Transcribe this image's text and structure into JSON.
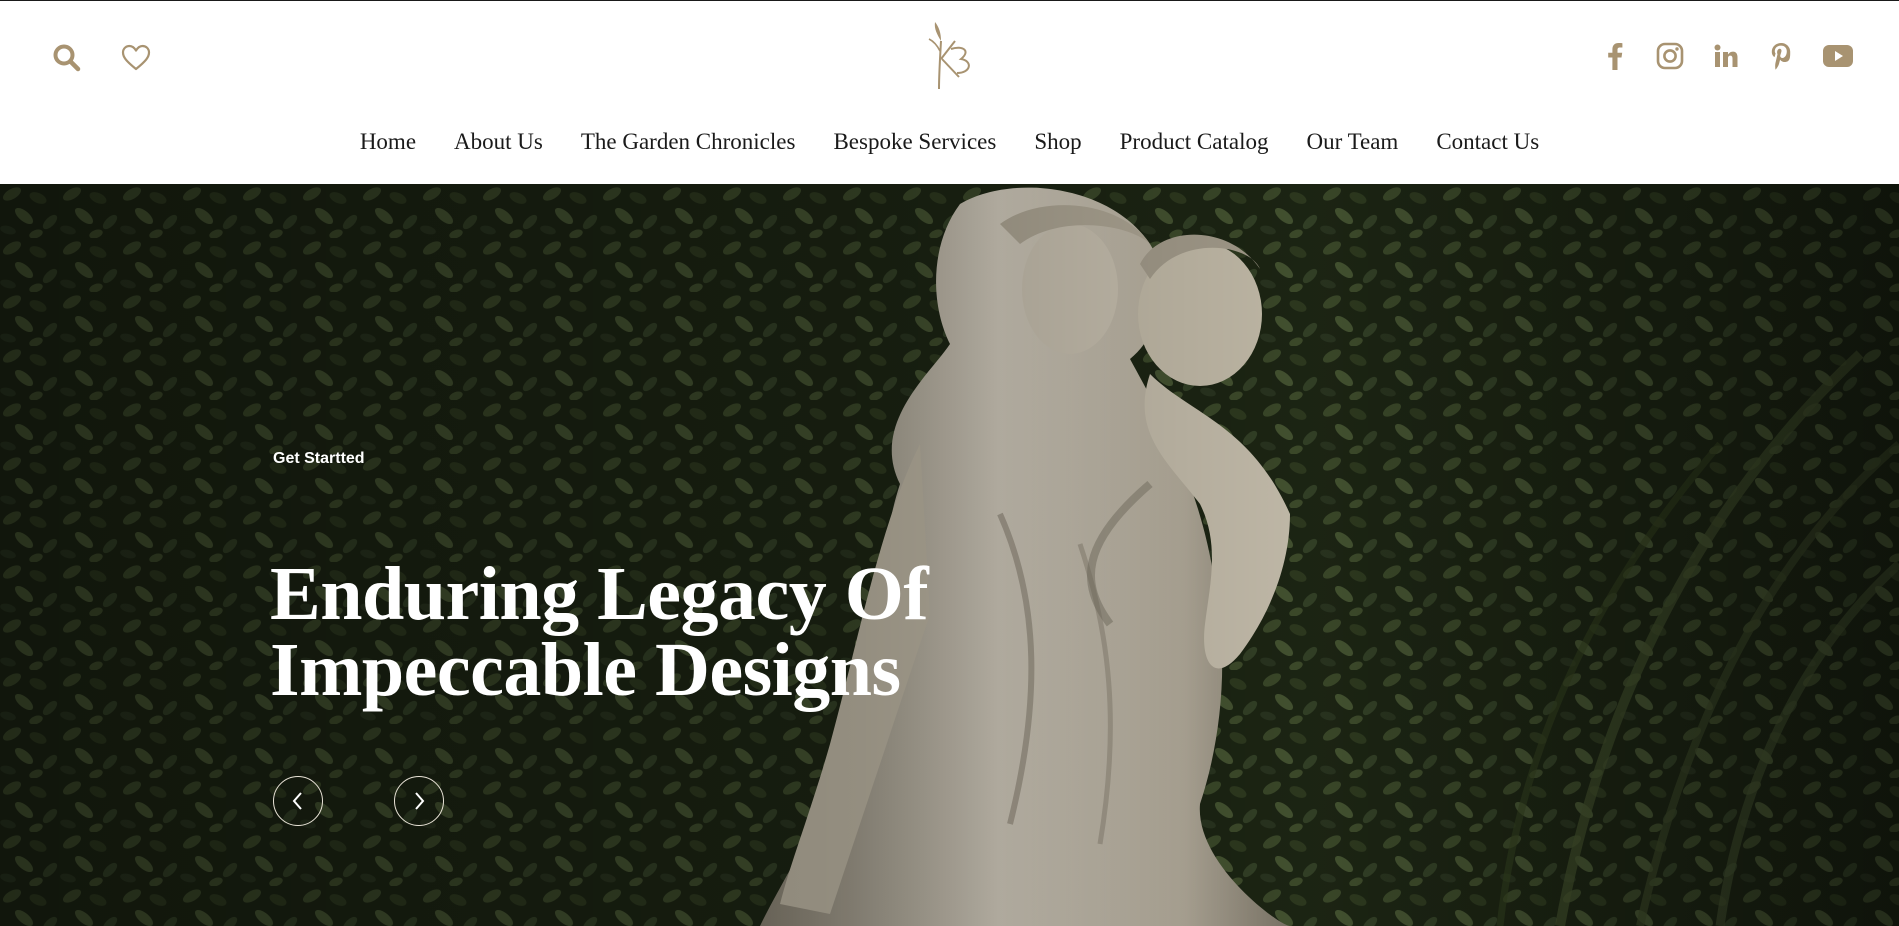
{
  "header": {
    "left_icons": [
      "search-icon",
      "heart-icon"
    ],
    "social_icons": [
      "facebook-icon",
      "instagram-icon",
      "linkedin-icon",
      "pinterest-icon",
      "youtube-icon"
    ],
    "accent_color": "#a89371"
  },
  "nav": {
    "items": [
      {
        "label": "Home"
      },
      {
        "label": "About Us"
      },
      {
        "label": "The Garden Chronicles"
      },
      {
        "label": "Bespoke Services"
      },
      {
        "label": "Shop"
      },
      {
        "label": "Product Catalog"
      },
      {
        "label": "Our Team"
      },
      {
        "label": "Contact Us"
      }
    ]
  },
  "hero": {
    "eyebrow": "Get Startted",
    "headline_line1": "Enduring Legacy Of",
    "headline_line2": "Impeccable Designs",
    "prev_icon": "chevron-left-icon",
    "next_icon": "chevron-right-icon"
  }
}
